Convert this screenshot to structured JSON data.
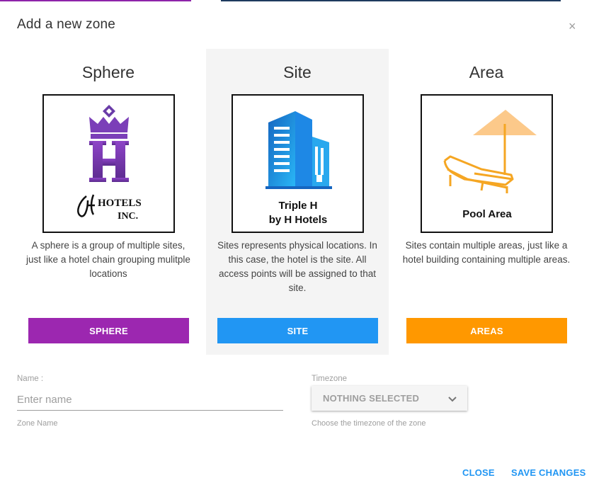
{
  "dialog": {
    "title": "Add a new zone",
    "close_glyph": "×"
  },
  "columns": [
    {
      "title": "Sphere",
      "image_caption_line1": "HOTELS",
      "image_caption_line2": "INC.",
      "description": "A sphere is a group of multiple sites, just like a hotel chain grouping mulitple locations",
      "button_label": "SPHERE",
      "color": "#9c27b0"
    },
    {
      "title": "Site",
      "image_caption_line1": "Triple H",
      "image_caption_line2": "by H Hotels",
      "description": "Sites represents physical locations. In this case, the hotel is the site. All access points will be assigned to that site.",
      "button_label": "SITE",
      "color": "#2196f3"
    },
    {
      "title": "Area",
      "image_caption_line1": "Pool Area",
      "description": "Sites contain multiple areas, just like a hotel building containing multiple areas.",
      "button_label": "AREAS",
      "color": "#ff9800"
    }
  ],
  "form": {
    "name_label": "Name :",
    "name_placeholder": "Enter name",
    "name_value": "",
    "name_helper": "Zone Name",
    "timezone_label": "Timezone",
    "timezone_selected": "NOTHING SELECTED",
    "timezone_helper": "Choose the timezone of the zone"
  },
  "actions": {
    "close_label": "CLOSE",
    "save_label": "SAVE CHANGES"
  }
}
